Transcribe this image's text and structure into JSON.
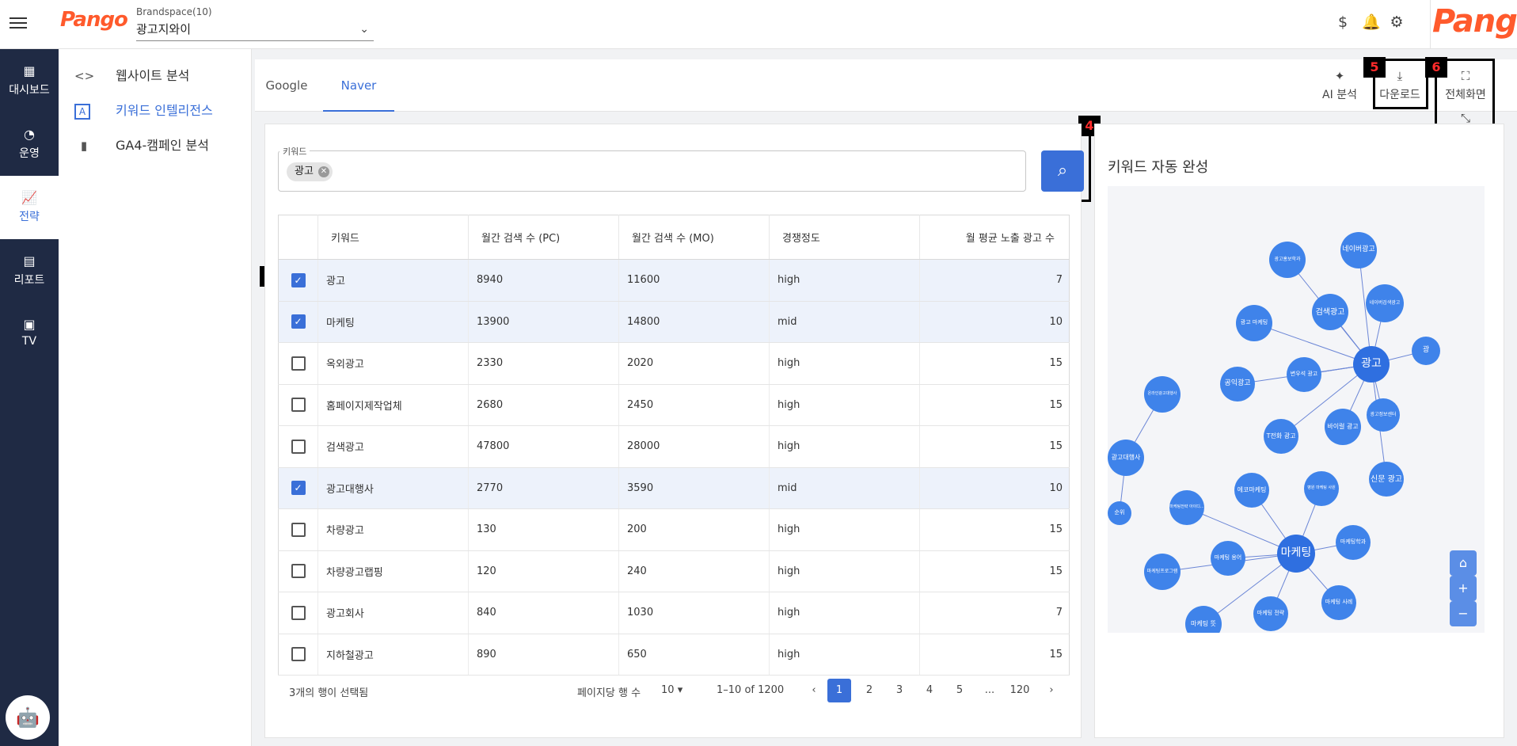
{
  "header": {
    "brand_label": "Brandspace(10)",
    "brand_value": "광고지와이",
    "logo_text": "Pango",
    "dollar_icon": "dollar-icon",
    "bell_icon": "bell-icon",
    "gear_icon": "gear-icon"
  },
  "sidenav": [
    {
      "label": "대시보드",
      "icon": "dashboard-icon"
    },
    {
      "label": "운영",
      "icon": "gauge-icon"
    },
    {
      "label": "전략",
      "icon": "chart-icon"
    },
    {
      "label": "리포트",
      "icon": "report-icon"
    },
    {
      "label": "TV",
      "icon": "tv-icon"
    }
  ],
  "subnav": [
    {
      "label": "웹사이트 분석",
      "icon": "code-icon"
    },
    {
      "label": "키워드 인텔리전스",
      "icon": "text-box-icon"
    },
    {
      "label": "GA4-캠페인 분석",
      "icon": "bar-chart-icon"
    }
  ],
  "tabs": [
    "Google",
    "Naver"
  ],
  "tools": {
    "ai": "AI 분석",
    "download": "다운로드",
    "fullscreen": "전체화면",
    "shrink": "축소"
  },
  "annotations": {
    "a4": "4",
    "a5": "5",
    "a6": "6"
  },
  "keyword": {
    "label": "키워드",
    "chip": "광고"
  },
  "table": {
    "headers": [
      "키워드",
      "월간 검색 수 (PC)",
      "월간 검색 수 (MO)",
      "경쟁정도",
      "월 평균 노출 광고 수"
    ],
    "rows": [
      {
        "kw": "광고",
        "pc": "8940",
        "mo": "11600",
        "comp": "high",
        "ads": "7",
        "checked": true
      },
      {
        "kw": "마케팅",
        "pc": "13900",
        "mo": "14800",
        "comp": "mid",
        "ads": "10",
        "checked": true
      },
      {
        "kw": "옥외광고",
        "pc": "2330",
        "mo": "2020",
        "comp": "high",
        "ads": "15",
        "checked": false
      },
      {
        "kw": "홈페이지제작업체",
        "pc": "2680",
        "mo": "2450",
        "comp": "high",
        "ads": "15",
        "checked": false
      },
      {
        "kw": "검색광고",
        "pc": "47800",
        "mo": "28000",
        "comp": "high",
        "ads": "15",
        "checked": false
      },
      {
        "kw": "광고대행사",
        "pc": "2770",
        "mo": "3590",
        "comp": "mid",
        "ads": "10",
        "checked": true
      },
      {
        "kw": "차량광고",
        "pc": "130",
        "mo": "200",
        "comp": "high",
        "ads": "15",
        "checked": false
      },
      {
        "kw": "차량광고랩핑",
        "pc": "120",
        "mo": "240",
        "comp": "high",
        "ads": "15",
        "checked": false
      },
      {
        "kw": "광고회사",
        "pc": "840",
        "mo": "1030",
        "comp": "high",
        "ads": "7",
        "checked": false
      },
      {
        "kw": "지하철광고",
        "pc": "890",
        "mo": "650",
        "comp": "high",
        "ads": "15",
        "checked": false
      }
    ]
  },
  "footer": {
    "selected": "3개의 행이 선택됨",
    "rows_per_page_label": "페이지당 행 수",
    "rows_per_page": "10",
    "range": "1–10 of 1200",
    "pages": [
      "1",
      "2",
      "3",
      "4",
      "5",
      "...",
      "120"
    ]
  },
  "autocomplete": {
    "title": "키워드 자동 완성",
    "nodes": [
      "광고",
      "마케팅",
      "네이버광고",
      "광고홍보학과",
      "검색광고",
      "네이버검색광고",
      "광고 마케팅",
      "광",
      "변우석 광고",
      "공익광고",
      "광고정보센터",
      "바이럴 광고",
      "T전화 광고",
      "신문 광고",
      "온라인광고대행사",
      "광고대행사",
      "에코마케팅",
      "병원 마케팅 사원",
      "마케팅전략 아이디...",
      "마케팅학과",
      "마케팅 용어",
      "마케팅프로그램",
      "마케팅 사례",
      "마케팅 전략",
      "마케팅 뜻",
      "순위"
    ]
  }
}
